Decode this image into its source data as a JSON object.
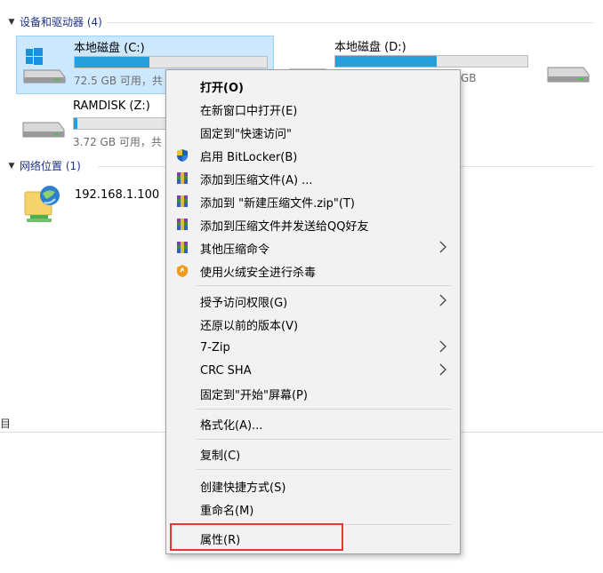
{
  "groups": {
    "devices": {
      "label": "设备和驱动器 (4)"
    },
    "network": {
      "label": "网络位置 (1)"
    }
  },
  "drives": [
    {
      "name": "本地磁盘 (C:)",
      "free_text": "72.5 GB 可用，共",
      "used_fraction": 0.39,
      "selected": true
    },
    {
      "name": "本地磁盘 (D:)",
      "free_text": "GB",
      "used_fraction": 0.53,
      "selected": false
    },
    {
      "name": "RAMDISK (Z:)",
      "free_text": "3.72 GB 可用，共",
      "used_fraction": 0.02,
      "selected": false
    }
  ],
  "network_items": [
    {
      "name": "192.168.1.100"
    }
  ],
  "status": {
    "left_text": "目"
  },
  "context_menu": {
    "items": [
      {
        "label": "打开(O)",
        "bold": true
      },
      {
        "label": "在新窗口中打开(E)"
      },
      {
        "label": "固定到\"快速访问\""
      },
      {
        "label": "启用 BitLocker(B)",
        "icon": "shield-icon"
      },
      {
        "label": "添加到压缩文件(A) ...",
        "icon": "archive-icon"
      },
      {
        "label": "添加到 \"新建压缩文件.zip\"(T)",
        "icon": "archive-icon"
      },
      {
        "label": "添加到压缩文件并发送给QQ好友",
        "icon": "archive-icon"
      },
      {
        "label": "其他压缩命令",
        "icon": "archive-icon",
        "submenu": true
      },
      {
        "label": "使用火绒安全进行杀毒",
        "icon": "huorong-icon"
      },
      {
        "label": "授予访问权限(G)",
        "submenu": true
      },
      {
        "label": "还原以前的版本(V)"
      },
      {
        "label": "7-Zip",
        "submenu": true
      },
      {
        "label": "CRC SHA",
        "submenu": true
      },
      {
        "label": "固定到\"开始\"屏幕(P)"
      },
      {
        "label": "格式化(A)..."
      },
      {
        "label": "复制(C)"
      },
      {
        "label": "创建快捷方式(S)"
      },
      {
        "label": "重命名(M)"
      },
      {
        "label": "属性(R)",
        "highlighted": true
      }
    ]
  },
  "colors": {
    "accent": "#26a0da",
    "selection": "#cce8ff",
    "highlight_border": "#e53935",
    "group_header": "#1e3287"
  }
}
